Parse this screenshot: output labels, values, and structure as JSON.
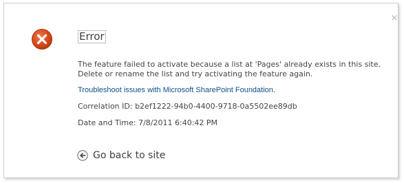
{
  "dialog": {
    "close_glyph": "×",
    "title": "Error",
    "message": "The feature failed to activate because a list at 'Pages' already exists in this site.  Delete or rename the list and try activating the feature again.",
    "troubleshoot_link": "Troubleshoot issues with Microsoft SharePoint Foundation.",
    "correlation": "Correlation ID: b2ef1222-94b0-4400-9718-0a5502ee89db",
    "datetime": "Date and Time: 7/8/2011 6:40:42 PM",
    "back_label": "Go back to site"
  },
  "icons": {
    "error": "error-x-circle-icon",
    "back": "back-arrow-icon",
    "close": "close-icon"
  },
  "colors": {
    "error_red": "#d84a1b",
    "link_blue": "#0b4f8a",
    "text_gray": "#444444"
  }
}
